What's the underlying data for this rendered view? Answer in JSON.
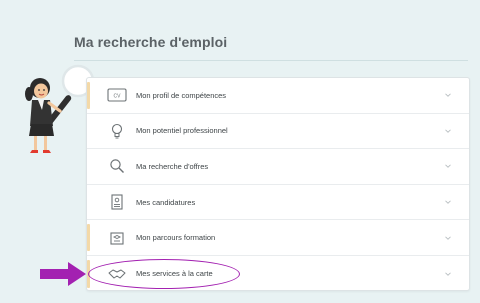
{
  "page": {
    "title": "Ma recherche d'emploi"
  },
  "menu": {
    "items": [
      {
        "label": "Mon profil de compétences",
        "icon": "id-card-icon",
        "accent": true
      },
      {
        "label": "Mon potentiel professionnel",
        "icon": "lightbulb-icon",
        "accent": false
      },
      {
        "label": "Ma recherche d'offres",
        "icon": "magnifier-icon",
        "accent": false
      },
      {
        "label": "Mes candidatures",
        "icon": "document-icon",
        "accent": false
      },
      {
        "label": "Mon parcours formation",
        "icon": "graduation-icon",
        "accent": true
      },
      {
        "label": "Mes services à la carte",
        "icon": "handshake-icon",
        "accent": true
      }
    ]
  },
  "annotation": {
    "highlight_color": "#a321b1",
    "highlighted_item": "Mes services à la carte"
  },
  "colors": {
    "background": "#e8f2f3",
    "accent": "#f3d9a8",
    "text": "#3e4447",
    "title": "#5b6266"
  }
}
